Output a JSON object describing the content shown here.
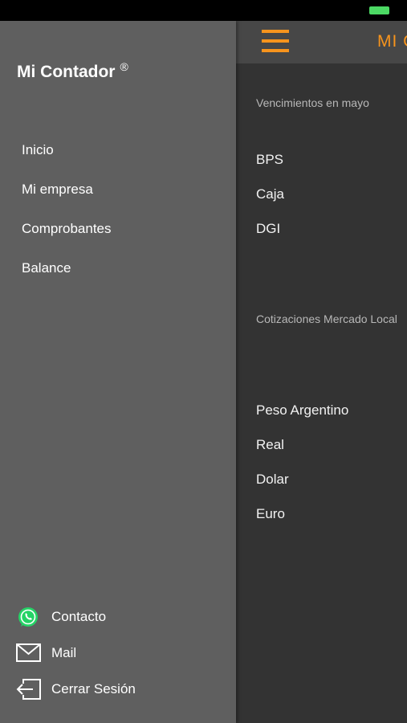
{
  "app": {
    "title": "Mi Contador",
    "trademark": "®",
    "header_title": "MI CONTADOR"
  },
  "colors": {
    "accent": "#f7941d",
    "drawer_bg": "#5f5f5f",
    "main_bg": "#333333",
    "header_bg": "#474747",
    "battery": "#4cd964",
    "whatsapp": "#25d366"
  },
  "menu": {
    "items": [
      {
        "label": "Inicio"
      },
      {
        "label": "Mi empresa"
      },
      {
        "label": "Comprobantes"
      },
      {
        "label": "Balance"
      }
    ]
  },
  "footer": {
    "contact": {
      "label": "Contacto",
      "icon": "whatsapp-icon"
    },
    "mail": {
      "label": "Mail",
      "icon": "mail-icon"
    },
    "logout": {
      "label": "Cerrar Sesión",
      "icon": "logout-icon"
    }
  },
  "main": {
    "vencimientos": {
      "label": "Vencimientos en mayo",
      "items": [
        "BPS",
        "Caja",
        "DGI"
      ]
    },
    "cotizaciones": {
      "label": "Cotizaciones Mercado Local",
      "items": [
        "Peso Argentino",
        "Real",
        "Dolar",
        "Euro"
      ]
    }
  }
}
